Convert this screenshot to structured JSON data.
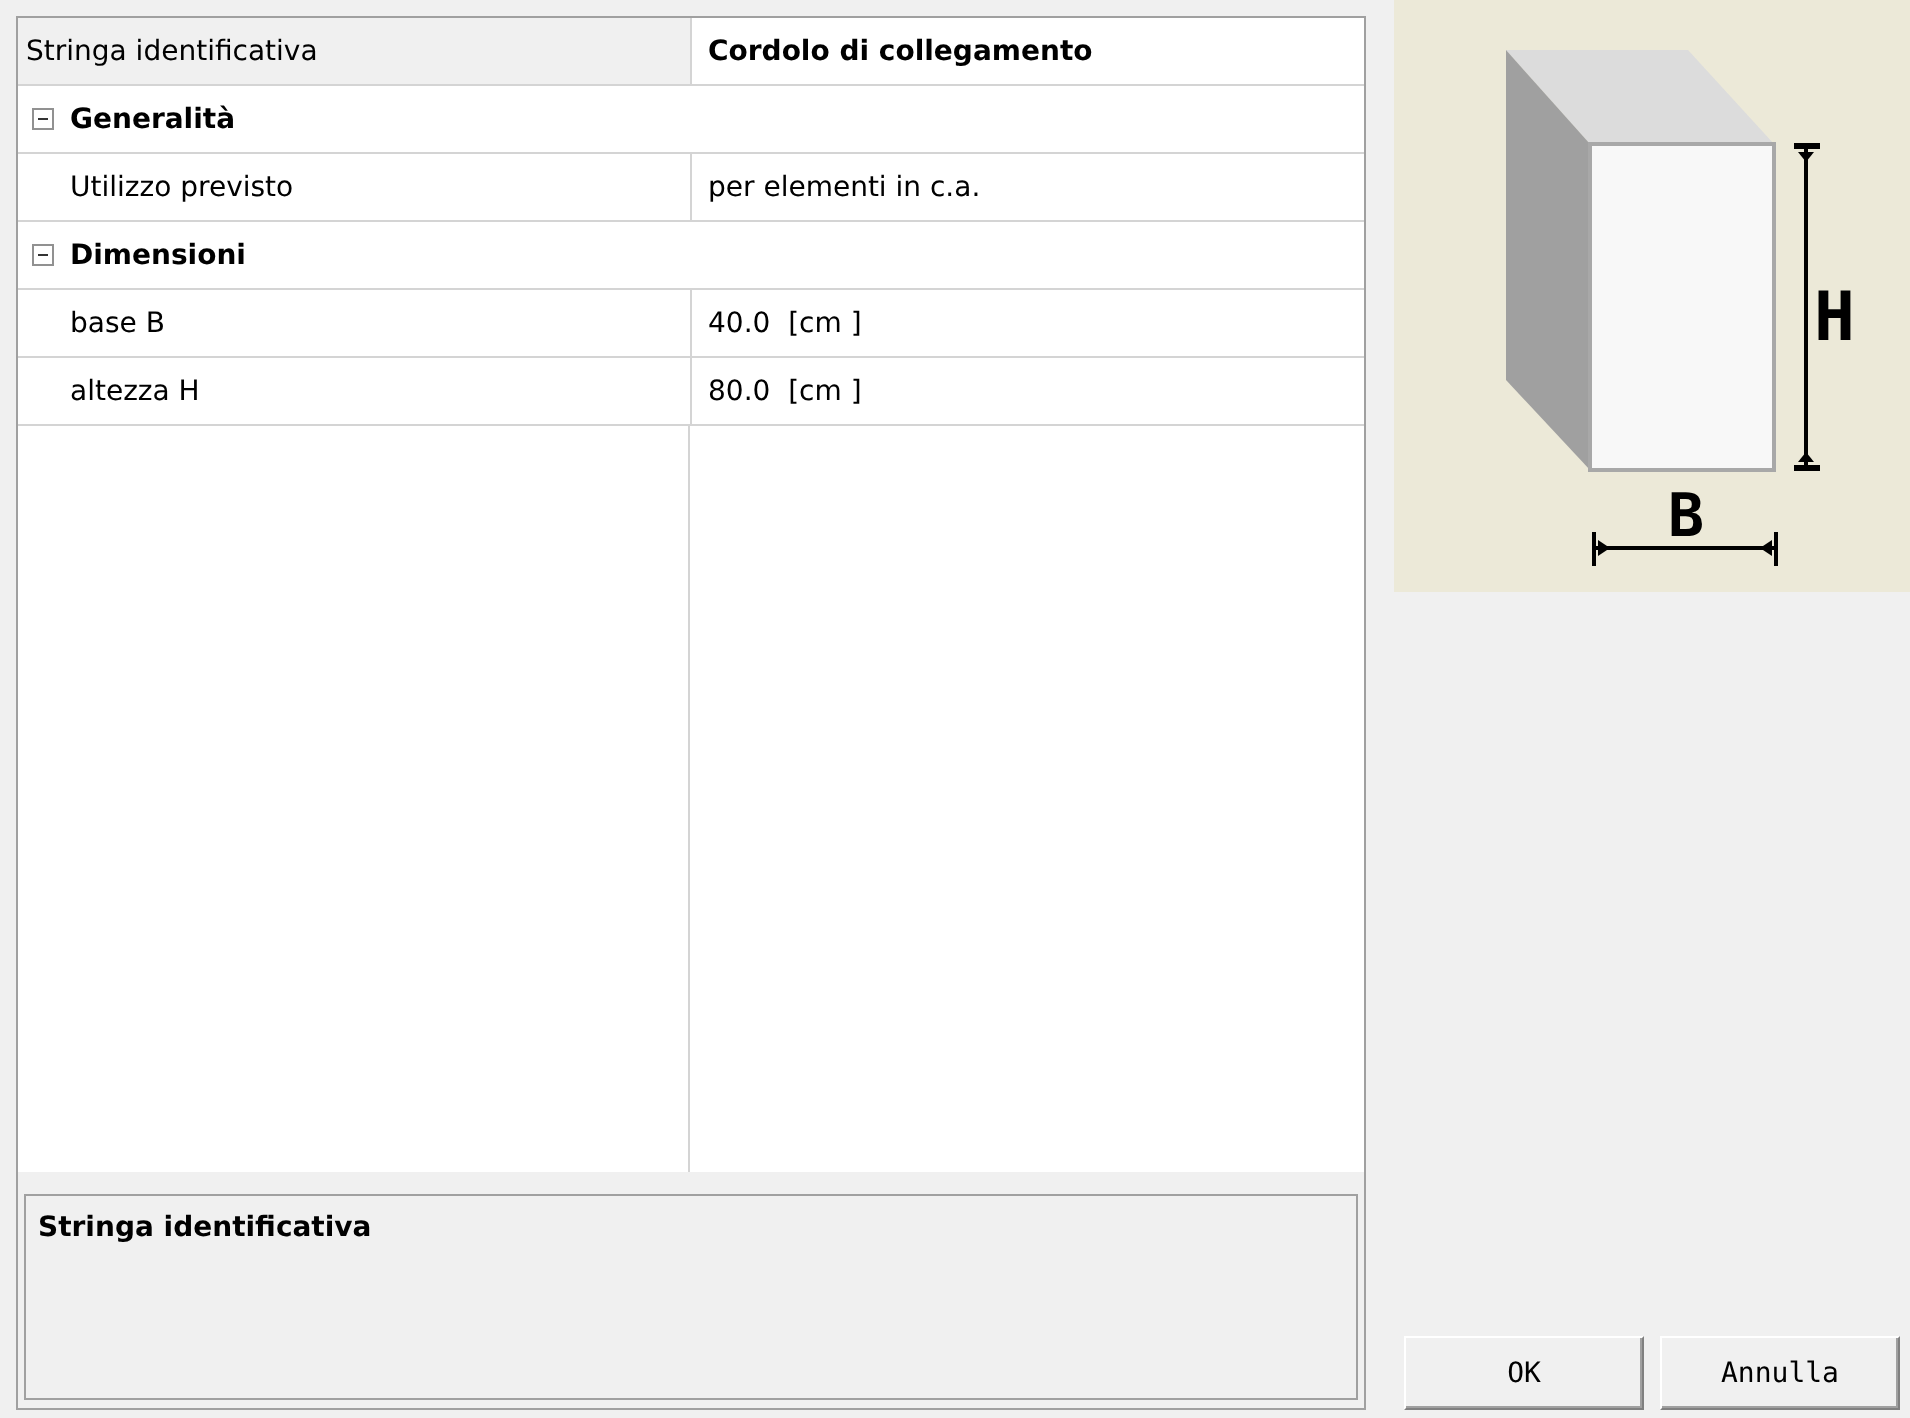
{
  "property_grid": {
    "rows": [
      {
        "kind": "property",
        "label": "Stringa identificativa",
        "value": "Cordolo di collegamento",
        "selected": true,
        "modified": true
      },
      {
        "kind": "category",
        "label": "Generalità",
        "expanded": true,
        "children": [
          {
            "kind": "property",
            "label": "Utilizzo previsto",
            "value": "per elementi in c.a.",
            "selected": false,
            "modified": false
          }
        ]
      },
      {
        "kind": "category",
        "label": "Dimensioni",
        "expanded": true,
        "children": [
          {
            "kind": "property",
            "label": "base B",
            "value": "40.0  [cm ]",
            "selected": false,
            "modified": false
          },
          {
            "kind": "property",
            "label": "altezza H",
            "value": "80.0  [cm ]",
            "selected": false,
            "modified": false
          }
        ]
      }
    ]
  },
  "description": {
    "title": "Stringa identificativa"
  },
  "preview": {
    "height_label": "H",
    "width_label": "B"
  },
  "buttons": [
    "OK",
    "Annulla"
  ]
}
